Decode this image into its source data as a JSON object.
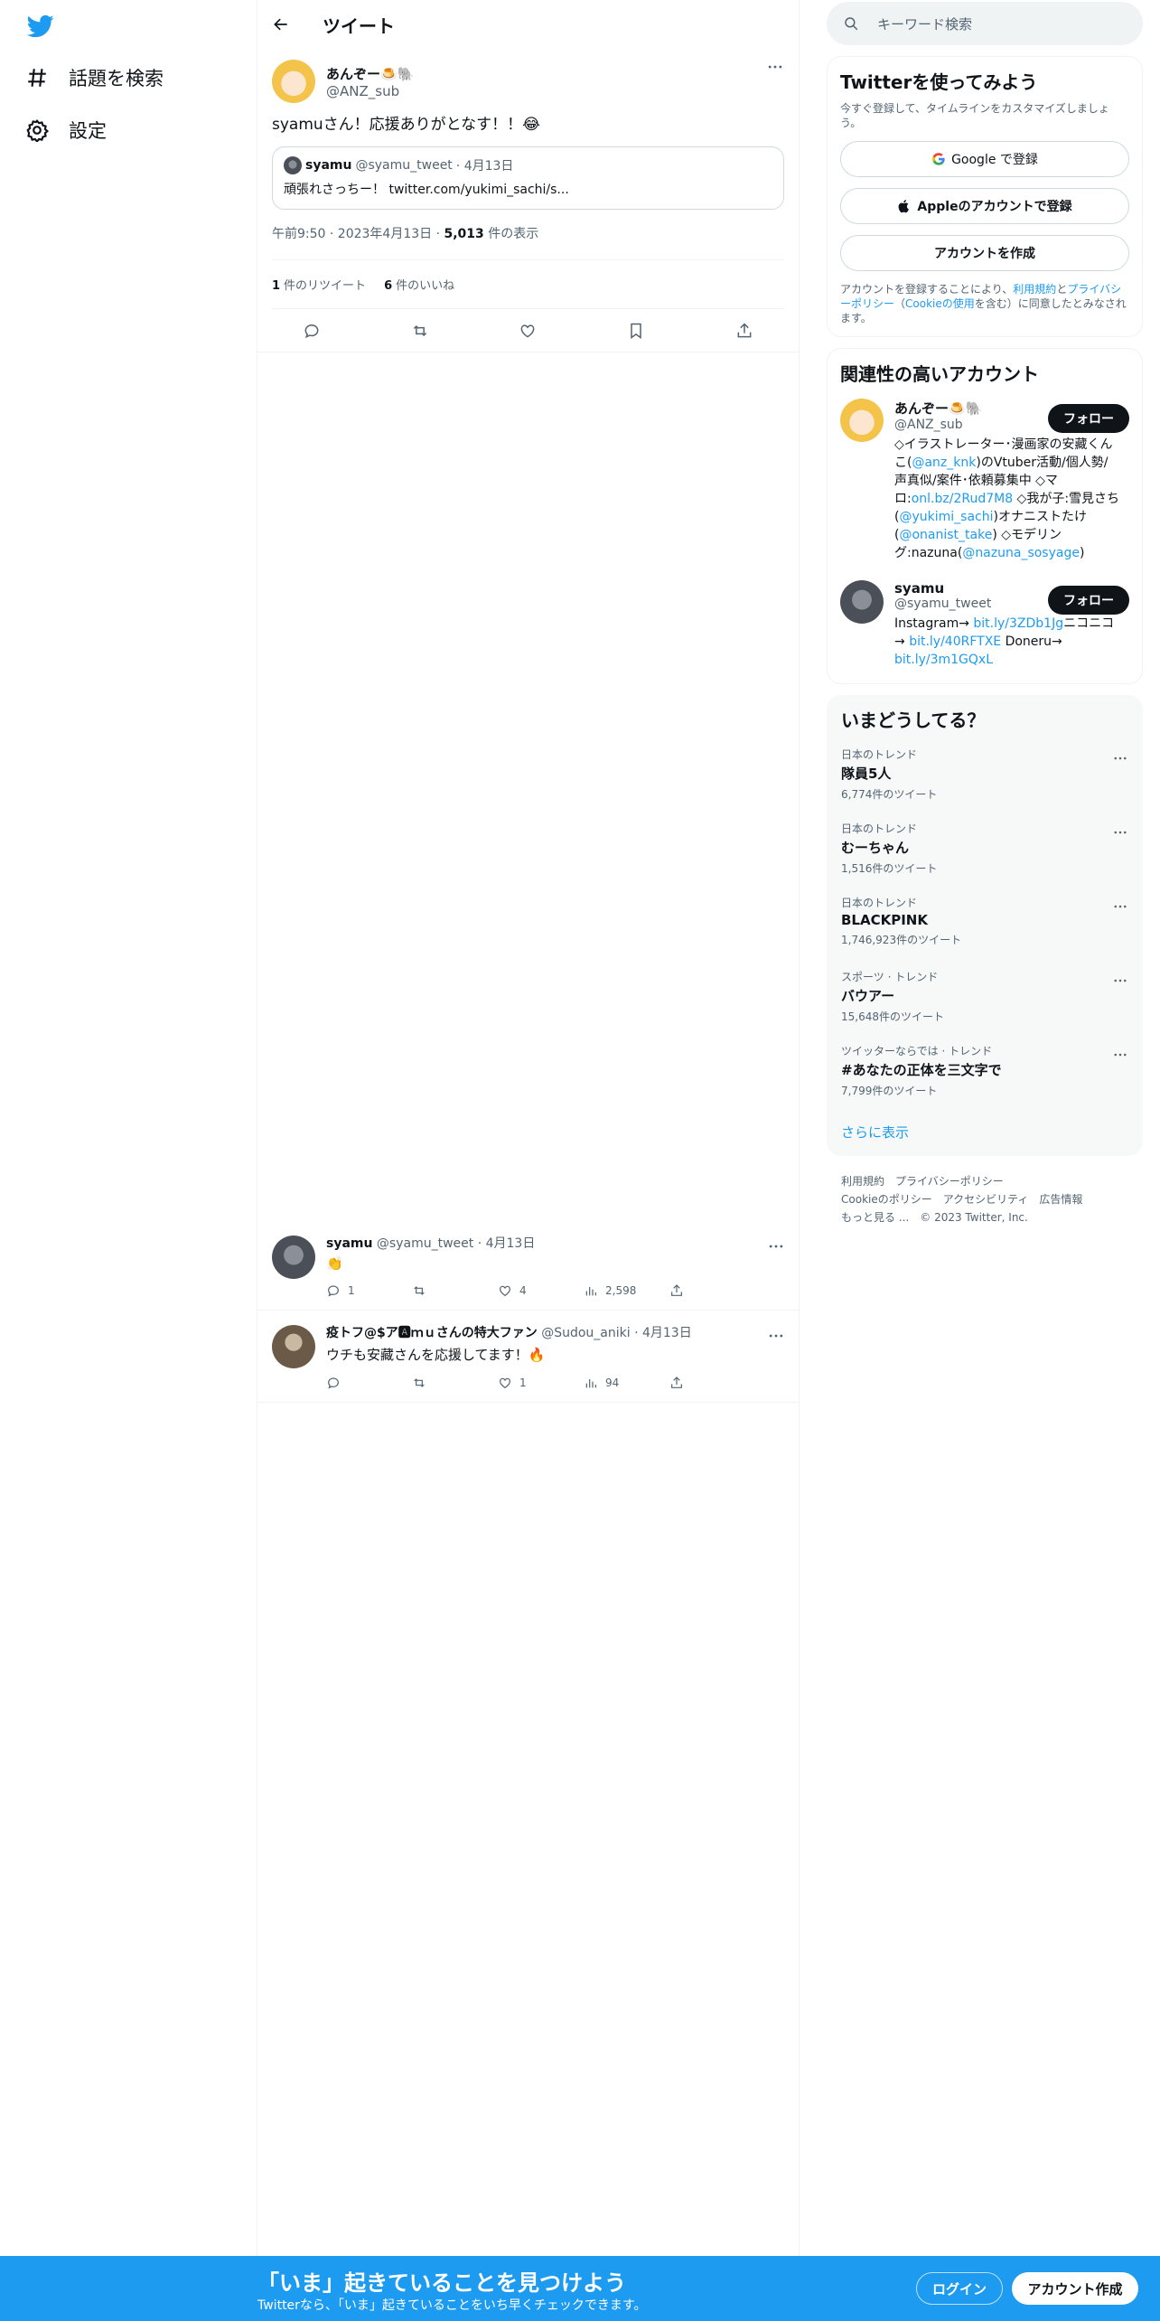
{
  "nav": {
    "items": [
      {
        "label": "話題を検索",
        "icon": "hashtag-icon"
      },
      {
        "label": "設定",
        "icon": "gear-icon"
      }
    ]
  },
  "header": {
    "title": "ツイート"
  },
  "main_tweet": {
    "author_name": "あんぞー🍮🐘",
    "author_handle": "@ANZ_sub",
    "text": "syamuさん！応援ありがとなす！！😂",
    "quote": {
      "author_name": "syamu",
      "author_handle": "@syamu_tweet",
      "date": "· 4月13日",
      "text": "頑張れさっちー！ twitter.com/yukimi_sachi/s..."
    },
    "timestamp": "午前9:50 · 2023年4月13日 · ",
    "views_count": "5,013",
    "views_label": " 件の表示",
    "retweets_count": "1",
    "retweets_label": "件のリツイート",
    "likes_count": "6",
    "likes_label": "件のいいね"
  },
  "replies": [
    {
      "author_name": "syamu",
      "author_handle": "@syamu_tweet",
      "date": "· 4月13日",
      "text": "👏",
      "reply_count": "1",
      "retweet_count": "",
      "like_count": "4",
      "views_count": "2,598"
    },
    {
      "author_name": "疫トフ@$ア🅰ｍｕさんの特大ファン",
      "author_handle": "@Sudou_aniki",
      "date": "· 4月13日",
      "text": "ウチも安藏さんを応援してます！🔥",
      "reply_count": "",
      "retweet_count": "",
      "like_count": "1",
      "views_count": "94"
    }
  ],
  "search": {
    "placeholder": "キーワード検索"
  },
  "signup_box": {
    "title": "Twitterを使ってみよう",
    "desc": "今すぐ登録して、タイムラインをカスタマイズしましょう。",
    "google_label": "Google で登録",
    "apple_label": "Appleのアカウントで登録",
    "create_label": "アカウントを作成",
    "legal_prefix": "アカウントを登録することにより、",
    "legal_terms": "利用規約",
    "legal_and": "と",
    "legal_privacy": "プライバシーポリシー",
    "legal_open": "（",
    "legal_cookie": "Cookieの使用",
    "legal_suffix": "を含む）に同意したとみなされます。"
  },
  "related": {
    "title": "関連性の高いアカウント",
    "follow_label": "フォロー",
    "accounts": [
      {
        "name": "あんぞー🍮🐘",
        "handle": "@ANZ_sub",
        "bio_parts": [
          {
            "t": "◇イラストレーター･漫画家の安藏くんこ(",
            "link": false
          },
          {
            "t": "@anz_knk",
            "link": true
          },
          {
            "t": ")のVtuber活動/個人勢/声真似/案件･依頼募集中 ◇マロ:",
            "link": false
          },
          {
            "t": "onl.bz/2Rud7M8",
            "link": true
          },
          {
            "t": " ◇我が子:雪見さち(",
            "link": false
          },
          {
            "t": "@yukimi_sachi",
            "link": true
          },
          {
            "t": ")オナニストたけ(",
            "link": false
          },
          {
            "t": "@onanist_take",
            "link": true
          },
          {
            "t": ") ◇モデリング:nazuna(",
            "link": false
          },
          {
            "t": "@nazuna_sosyage",
            "link": true
          },
          {
            "t": ")",
            "link": false
          }
        ]
      },
      {
        "name": "syamu",
        "handle": "@syamu_tweet",
        "bio_parts": [
          {
            "t": "Instagram→ ",
            "link": false
          },
          {
            "t": "bit.ly/3ZDb1Jg",
            "link": true
          },
          {
            "t": "ニコニコ→ ",
            "link": false
          },
          {
            "t": "bit.ly/40RFTXE",
            "link": true
          },
          {
            "t": " Doneru→ ",
            "link": false
          },
          {
            "t": "bit.ly/3m1GQxL",
            "link": true
          }
        ]
      }
    ]
  },
  "trends": {
    "title": "いまどうしてる？",
    "items": [
      {
        "context": "日本のトレンド",
        "name": "隊員5人",
        "count": "6,774件のツイート"
      },
      {
        "context": "日本のトレンド",
        "name": "むーちゃん",
        "count": "1,516件のツイート"
      },
      {
        "context": "日本のトレンド",
        "name": "BLACKPINK",
        "count": "1,746,923件のツイート"
      },
      {
        "context": "スポーツ · トレンド",
        "name": "バウアー",
        "count": "15,648件のツイート"
      },
      {
        "context": "ツイッターならでは · トレンド",
        "name": "#あなたの正体を三文字で",
        "count": "7,799件のツイート"
      }
    ],
    "show_more": "さらに表示"
  },
  "footer": {
    "links": [
      "利用規約",
      "プライバシーポリシー",
      "Cookieのポリシー",
      "アクセシビリティ",
      "広告情報",
      "もっと見る ..."
    ],
    "copyright": "© 2023 Twitter, Inc."
  },
  "bottom_bar": {
    "title": "「いま」起きていることを見つけよう",
    "subtitle": "Twitterなら、「いま」起きていることをいち早くチェックできます。",
    "login_label": "ログイン",
    "signup_label": "アカウント作成"
  },
  "colors": {
    "accent": "#1d9bf0",
    "text": "#0f1419",
    "muted": "#536471"
  }
}
